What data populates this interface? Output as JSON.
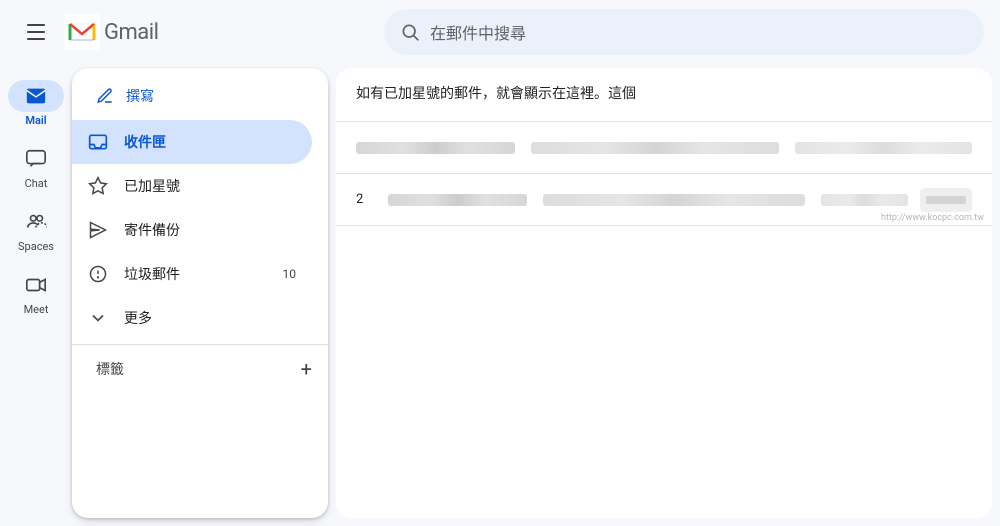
{
  "header": {
    "title": "Gmail",
    "search_placeholder": "在郵件中搜尋"
  },
  "sidebar": {
    "items": [
      {
        "id": "mail",
        "label": "Mail",
        "active": true
      },
      {
        "id": "chat",
        "label": "Chat",
        "active": false
      },
      {
        "id": "spaces",
        "label": "Spaces",
        "active": false
      },
      {
        "id": "meet",
        "label": "Meet",
        "active": false
      }
    ]
  },
  "nav": {
    "compose_label": "撰寫",
    "items": [
      {
        "id": "inbox",
        "label": "收件匣",
        "badge": "",
        "active": true
      },
      {
        "id": "starred",
        "label": "已加星號",
        "badge": "",
        "active": false
      },
      {
        "id": "sent",
        "label": "寄件備份",
        "badge": "",
        "active": false
      },
      {
        "id": "spam",
        "label": "垃圾郵件",
        "badge": "10",
        "active": false
      },
      {
        "id": "more",
        "label": "更多",
        "badge": "",
        "active": false
      }
    ],
    "labels_title": "標籤",
    "labels_add": "+"
  },
  "content": {
    "starred_info": "如有已加星號的郵件，就會顯示在這裡。這個",
    "email_rows": [
      {
        "number": "",
        "preview": "blurred content row 1"
      },
      {
        "number": "2",
        "preview": "blurred content row 2"
      }
    ]
  }
}
